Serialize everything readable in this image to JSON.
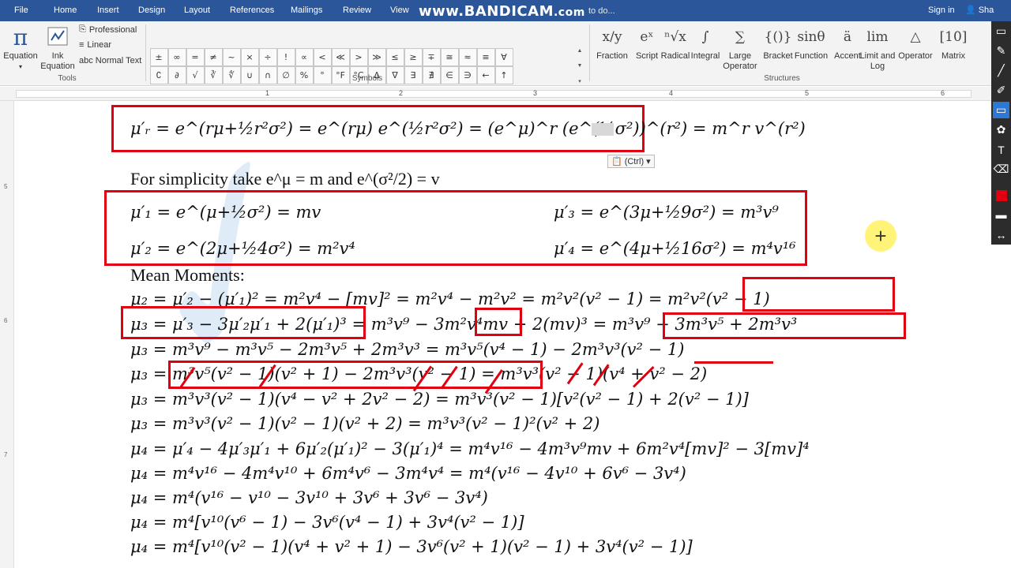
{
  "tabs": [
    "File",
    "Home",
    "Insert",
    "Design",
    "Layout",
    "References",
    "Mailings",
    "Review",
    "View"
  ],
  "tellme": "to do...",
  "signin": "Sign in",
  "share": "Sha",
  "watermark": {
    "main": "www.BANDICAM",
    "tld": ".com"
  },
  "tools": {
    "equation": "Equation",
    "ink_equation": "Ink\nEquation",
    "professional": "Professional",
    "linear": "Linear",
    "normal_text": "abc Normal Text",
    "group_label": "Tools"
  },
  "symbols": {
    "row1": [
      "±",
      "∞",
      "=",
      "≠",
      "~",
      "×",
      "÷",
      "!",
      "∝",
      "<",
      "≪",
      ">",
      "≫",
      "≤",
      "≥",
      "∓",
      "≅",
      "≈",
      "≡",
      "∀"
    ],
    "row2": [
      "∁",
      "∂",
      "√",
      "∛",
      "∜",
      "∪",
      "∩",
      "∅",
      "%",
      "°",
      "°F",
      "°C",
      "∆",
      "∇",
      "∃",
      "∄",
      "∈",
      "∋",
      "←",
      "↑"
    ],
    "group_label": "Symbols"
  },
  "structures": {
    "items": [
      {
        "icon": "x/y",
        "label": "Fraction"
      },
      {
        "icon": "eˣ",
        "label": "Script"
      },
      {
        "icon": "ⁿ√x",
        "label": "Radical"
      },
      {
        "icon": "∫",
        "label": "Integral"
      },
      {
        "icon": "∑",
        "label": "Large\nOperator"
      },
      {
        "icon": "{()}",
        "label": "Bracket"
      },
      {
        "icon": "sinθ",
        "label": "Function"
      },
      {
        "icon": "ä",
        "label": "Accent"
      },
      {
        "icon": "lim",
        "label": "Limit and\nLog"
      },
      {
        "icon": "△",
        "label": "Operator"
      },
      {
        "icon": "[10]",
        "label": "Matrix"
      }
    ],
    "group_label": "Structures"
  },
  "ruler": [
    "1",
    "2",
    "3",
    "4",
    "5",
    "6"
  ],
  "vruler": [
    "5",
    "6",
    "7"
  ],
  "paste_ctrl": "(Ctrl)",
  "document": {
    "eq_mr": "μ′ᵣ = e^(rμ+½r²σ²) = e^(rμ) e^(½r²σ²) = (e^μ)^r (e^(½σ²))^(r²) = m^r v^(r²)",
    "simplicity": "For simplicity take e^μ = m and e^(σ²/2) = v",
    "eq_m1": "μ′₁ = e^(μ+½σ²) = mv",
    "eq_m3": "μ′₃ = e^(3μ+½9σ²) = m³v⁹",
    "eq_m2": "μ′₂ = e^(2μ+½4σ²) = m²v⁴",
    "eq_m4": "μ′₄ = e^(4μ+½16σ²) = m⁴v¹⁶",
    "mean_moments": "Mean Moments:",
    "lines": [
      "μ₂ = μ′₂ − (μ′₁)² = m²v⁴ − [mv]² = m²v⁴ − m²v² = m²v²(v² − 1) = m²v²(v² − 1)",
      "μ₃ = μ′₃ − 3μ′₂μ′₁ + 2(μ′₁)³ = m³v⁹ − 3m²v⁴mv + 2(mv)³ = m³v⁹ − 3m³v⁵ + 2m³v³",
      "μ₃ = m³v⁹ − m³v⁵ − 2m³v⁵ + 2m³v³ = m³v⁵(v⁴ − 1) − 2m³v³(v² − 1)",
      "μ₃ = m³v⁵(v² − 1)(v² + 1) − 2m³v³(v² − 1) = m³v³(v² − 1)(v⁴ + v² − 2)",
      "μ₃ = m³v³(v² − 1)(v⁴ − v² + 2v² − 2) = m³v³(v² − 1)[v²(v² − 1) + 2(v² − 1)]",
      "μ₃ = m³v³(v² − 1)(v² − 1)(v² + 2) = m³v³(v² − 1)²(v² + 2)",
      "μ₄ = μ′₄ − 4μ′₃μ′₁ + 6μ′₂(μ′₁)² − 3(μ′₁)⁴ = m⁴v¹⁶ − 4m³v⁹mv + 6m²v⁴[mv]² − 3[mv]⁴",
      "μ₄ = m⁴v¹⁶ − 4m⁴v¹⁰ + 6m⁴v⁶ − 3m⁴v⁴ = m⁴(v¹⁶ − 4v¹⁰ + 6v⁶ − 3v⁴)",
      "μ₄ = m⁴(v¹⁶ − v¹⁰ − 3v¹⁰ + 3v⁶ + 3v⁶ − 3v⁴)",
      "μ₄ = m⁴[v¹⁰(v⁶ − 1) − 3v⁶(v⁴ − 1) + 3v⁴(v² − 1)]",
      "μ₄ = m⁴[v¹⁰(v² − 1)(v⁴ + v² + 1) − 3v⁶(v² + 1)(v² − 1) + 3v⁴(v² − 1)]"
    ]
  },
  "colors": {
    "ribbon_blue": "#2b579a",
    "annotation_red": "#e0000f",
    "highlight": "#fff36a"
  }
}
